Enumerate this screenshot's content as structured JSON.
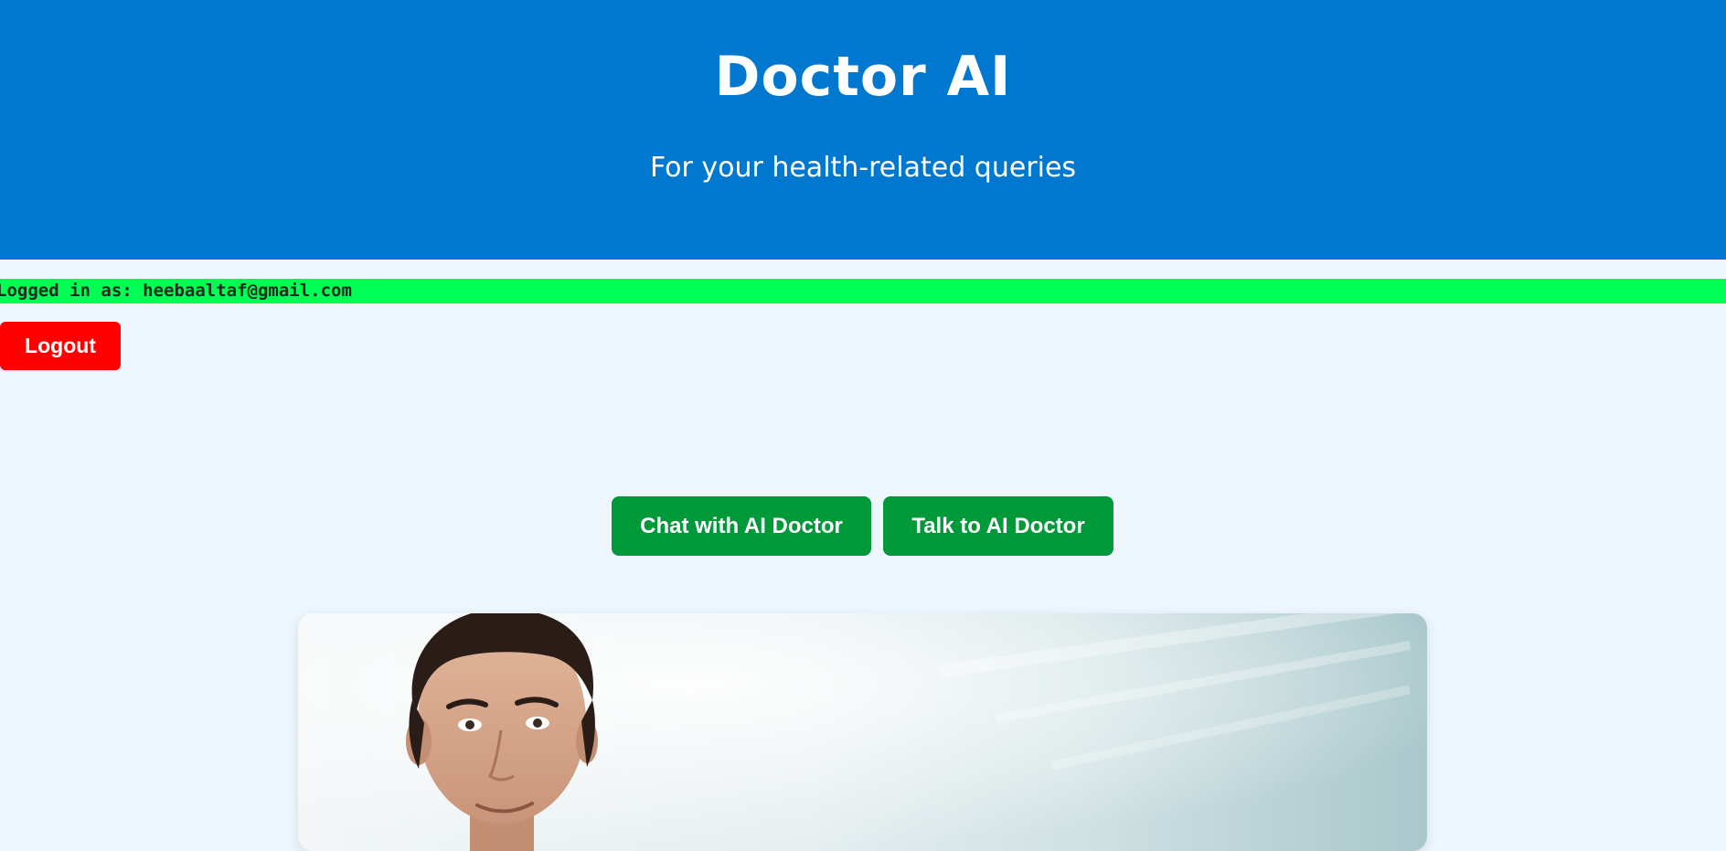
{
  "header": {
    "title": "Doctor AI",
    "subtitle": "For your health-related queries"
  },
  "session": {
    "logged_in_text": "Logged in as: heebaaltaf@gmail.com",
    "logout_label": "Logout"
  },
  "actions": {
    "chat_label": "Chat with AI Doctor",
    "talk_label": "Talk to AI Doctor"
  },
  "colors": {
    "header_bg": "#0078cf",
    "page_bg": "#eef7ff",
    "login_bar_bg": "#00ff55",
    "logout_bg": "#ff0000",
    "action_bg": "#00993a"
  }
}
